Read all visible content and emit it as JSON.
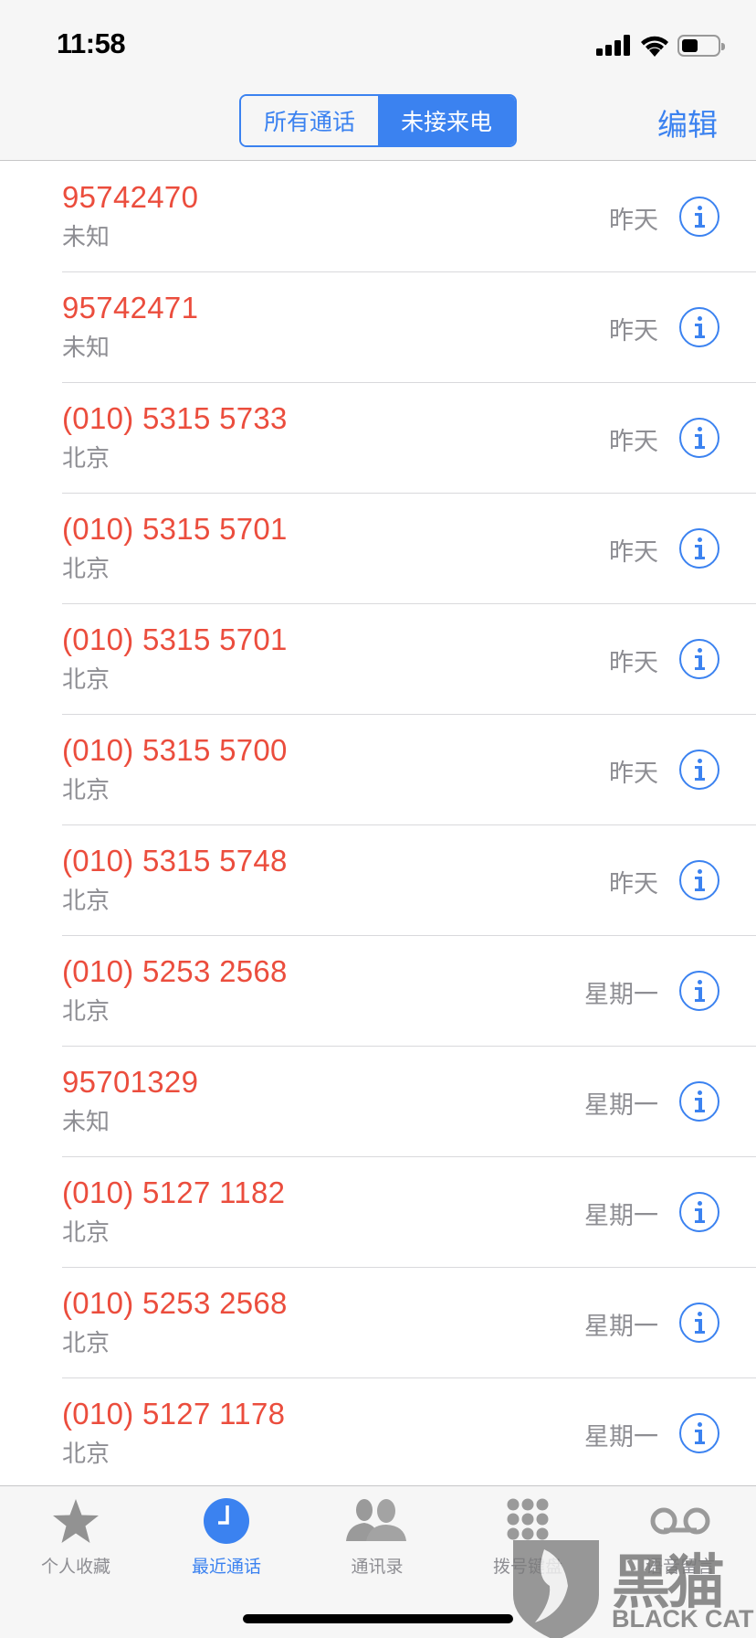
{
  "status_bar": {
    "time": "11:58",
    "battery_level_fraction": 0.45
  },
  "nav": {
    "segments": [
      {
        "label": "所有通话",
        "active": false
      },
      {
        "label": "未接来电",
        "active": true
      }
    ],
    "edit_label": "编辑"
  },
  "colors": {
    "accent": "#3b82f0",
    "missed_call": "#eb4d3d",
    "secondary_text": "#8e8e93"
  },
  "calls": [
    {
      "number": "95742470",
      "location": "未知",
      "date": "昨天"
    },
    {
      "number": "95742471",
      "location": "未知",
      "date": "昨天"
    },
    {
      "number": "(010) 5315 5733",
      "location": "北京",
      "date": "昨天"
    },
    {
      "number": "(010) 5315 5701",
      "location": "北京",
      "date": "昨天"
    },
    {
      "number": "(010) 5315 5701",
      "location": "北京",
      "date": "昨天"
    },
    {
      "number": "(010) 5315 5700",
      "location": "北京",
      "date": "昨天"
    },
    {
      "number": "(010) 5315 5748",
      "location": "北京",
      "date": "昨天"
    },
    {
      "number": "(010) 5253 2568",
      "location": "北京",
      "date": "星期一"
    },
    {
      "number": "95701329",
      "location": "未知",
      "date": "星期一"
    },
    {
      "number": "(010) 5127 1182",
      "location": "北京",
      "date": "星期一"
    },
    {
      "number": "(010) 5253 2568",
      "location": "北京",
      "date": "星期一"
    },
    {
      "number": "(010) 5127 1178",
      "location": "北京",
      "date": "星期一"
    }
  ],
  "tabs": [
    {
      "label": "个人收藏",
      "icon": "star-icon",
      "active": false
    },
    {
      "label": "最近通话",
      "icon": "clock-icon",
      "active": true
    },
    {
      "label": "通讯录",
      "icon": "contacts-icon",
      "active": false
    },
    {
      "label": "拨号键盘",
      "icon": "keypad-icon",
      "active": false
    },
    {
      "label": "语音留言",
      "icon": "voicemail-icon",
      "active": false
    }
  ],
  "watermark": {
    "text_cn": "黑猫",
    "text_en": "BLACK CAT"
  }
}
